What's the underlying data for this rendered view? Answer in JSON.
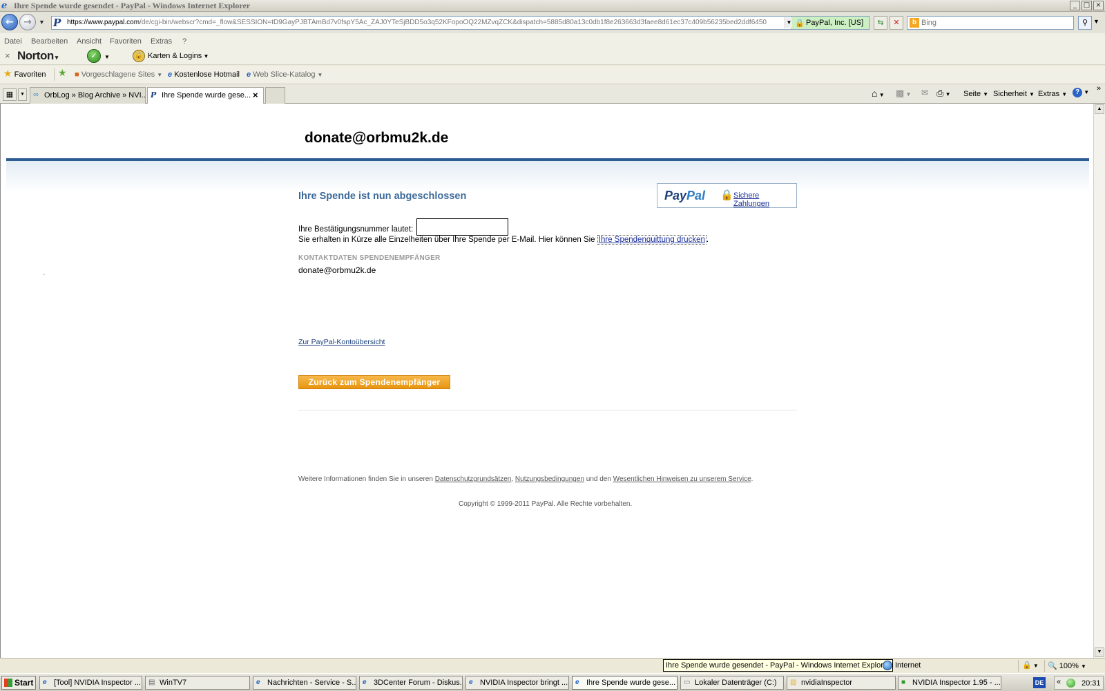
{
  "window": {
    "title": "Ihre Spende wurde gesendet - PayPal - Windows Internet Explorer",
    "controls": [
      "_",
      "□",
      "×"
    ]
  },
  "address_bar": {
    "url_scheme": "https://",
    "url_domain": "www.paypal.com",
    "url_path": "/de/cgi-bin/webscr?cmd=_flow&SESSION=tD9GayPJBTAmBd7v0fspY5Ac_ZAJ0YTeSjBDD5o3q52KFopoOQ22MZvqZCK&dispatch=5885d80a13c0db1f8e263663d3faee8d61ec37c409b56235bed2ddf6450",
    "security_label": "PayPal, Inc. [US]",
    "search_placeholder": "Bing"
  },
  "menu": [
    "Datei",
    "Bearbeiten",
    "Ansicht",
    "Favoriten",
    "Extras",
    "?"
  ],
  "norton": {
    "brand": "Norton",
    "cards_logins": "Karten & Logins"
  },
  "favorites_bar": {
    "favorites": "Favoriten",
    "suggested": "Vorgeschlagene Sites",
    "hotmail": "Kostenlose Hotmail",
    "webslice": "Web Slice-Katalog"
  },
  "tabs": [
    {
      "label": "OrbLog » Blog Archive » NVI..."
    },
    {
      "label": "Ihre Spende wurde gese..."
    }
  ],
  "command_bar": {
    "page": "Seite",
    "security": "Sicherheit",
    "tools": "Extras"
  },
  "page": {
    "recipient_header": "donate@orbmu2k.de",
    "done_title": "Ihre Spende ist nun abgeschlossen",
    "paypal_logo_pay": "Pay",
    "paypal_logo_pal": "Pal",
    "secure_payments": "Sichere Zahlungen",
    "confirmation_label": "Ihre Bestätigungsnummer lautet:",
    "info_text": "Sie erhalten in Kürze alle Einzelheiten über Ihre Spende per E-Mail. Hier können Sie ",
    "print_receipt_link": "Ihre Spendenquittung drucken",
    "info_end": ".",
    "contact_heading": "KONTAKTDATEN SPENDENEMPFÄNGER",
    "contact_email": "donate@orbmu2k.de",
    "overview_link": "Zur PayPal-Kontoübersicht",
    "return_button": "Zurück zum Spendenempfänger",
    "footer_prefix": "Weitere Informationen finden Sie in unseren ",
    "footer_privacy": "Datenschutzgrundsätzen",
    "footer_comma": ", ",
    "footer_terms": "Nutzungsbedingungen",
    "footer_and": " und den ",
    "footer_notes": "Wesentlichen Hinweisen zu unserem Service",
    "footer_end": ".",
    "copyright": "Copyright © 1999-2011 PayPal. Alle Rechte vorbehalten."
  },
  "status_bar": {
    "tooltip": "Ihre Spende wurde gesendet - PayPal - Windows Internet Explorer",
    "zone": "Internet",
    "zoom": "100%"
  },
  "taskbar": {
    "start": "Start",
    "items": [
      "[Tool] NVIDIA Inspector ...",
      "WinTV7",
      "Nachrichten - Service - S...",
      "3DCenter Forum - Diskus...",
      "NVIDIA Inspector bringt ...",
      "Ihre Spende wurde gese...",
      "Lokaler Datenträger (C:)",
      "nvidiaInspector",
      "NVIDIA Inspector 1.95 - ..."
    ],
    "language": "DE",
    "clock": "20:31"
  }
}
